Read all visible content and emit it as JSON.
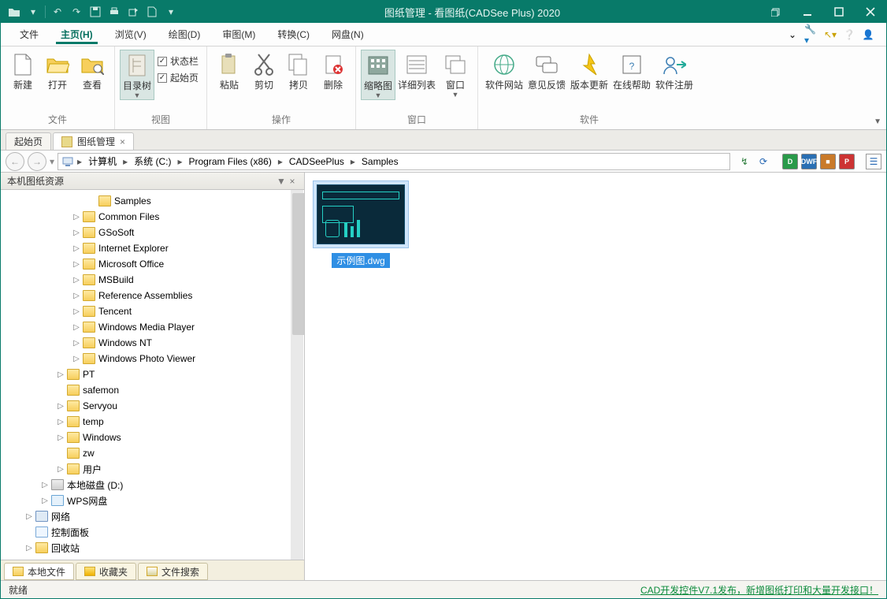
{
  "title": "图纸管理 - 看图纸(CADSee Plus) 2020",
  "menus": {
    "file": "文件",
    "home": "主页(H)",
    "browse": "浏览(V)",
    "draw": "绘图(D)",
    "review": "审图(M)",
    "convert": "转换(C)",
    "cloud": "网盘(N)"
  },
  "ribbon": {
    "file": {
      "label": "文件",
      "new": "新建",
      "open": "打开",
      "view": "查看"
    },
    "view": {
      "label": "视图",
      "tree": "目录树",
      "chk_status": "状态栏",
      "chk_start": "起始页"
    },
    "ops": {
      "label": "操作",
      "paste": "粘贴",
      "cut": "剪切",
      "copy": "拷贝",
      "del": "删除"
    },
    "win": {
      "label": "窗口",
      "thumb": "缩略图",
      "detail": "详细列表",
      "window": "窗口"
    },
    "soft": {
      "label": "软件",
      "site": "软件网站",
      "feedback": "意见反馈",
      "update": "版本更新",
      "help": "在线帮助",
      "reg": "软件注册"
    }
  },
  "tabs": {
    "start": "起始页",
    "mgr": "图纸管理"
  },
  "addr": {
    "segs": [
      "计算机",
      "系统 (C:)",
      "Program Files (x86)",
      "CADSeePlus",
      "Samples"
    ]
  },
  "sidebar": {
    "title": "本机图纸资源",
    "bottom_tabs": {
      "local": "本地文件",
      "fav": "收藏夹",
      "search": "文件搜索"
    },
    "nodes": [
      {
        "indent": 110,
        "tw": "",
        "icon": "folder",
        "label": "Samples",
        "sel": false
      },
      {
        "indent": 90,
        "tw": "▷",
        "icon": "folder",
        "label": "Common Files"
      },
      {
        "indent": 90,
        "tw": "▷",
        "icon": "folder",
        "label": "GSoSoft"
      },
      {
        "indent": 90,
        "tw": "▷",
        "icon": "folder",
        "label": "Internet Explorer"
      },
      {
        "indent": 90,
        "tw": "▷",
        "icon": "folder",
        "label": "Microsoft Office"
      },
      {
        "indent": 90,
        "tw": "▷",
        "icon": "folder",
        "label": "MSBuild"
      },
      {
        "indent": 90,
        "tw": "▷",
        "icon": "folder",
        "label": "Reference Assemblies"
      },
      {
        "indent": 90,
        "tw": "▷",
        "icon": "folder",
        "label": "Tencent"
      },
      {
        "indent": 90,
        "tw": "▷",
        "icon": "folder",
        "label": "Windows Media Player"
      },
      {
        "indent": 90,
        "tw": "▷",
        "icon": "folder",
        "label": "Windows NT"
      },
      {
        "indent": 90,
        "tw": "▷",
        "icon": "folder",
        "label": "Windows Photo Viewer"
      },
      {
        "indent": 70,
        "tw": "▷",
        "icon": "folder",
        "label": "PT"
      },
      {
        "indent": 70,
        "tw": "",
        "icon": "folder",
        "label": "safemon"
      },
      {
        "indent": 70,
        "tw": "▷",
        "icon": "folder",
        "label": "Servyou"
      },
      {
        "indent": 70,
        "tw": "▷",
        "icon": "folder",
        "label": "temp"
      },
      {
        "indent": 70,
        "tw": "▷",
        "icon": "folder",
        "label": "Windows"
      },
      {
        "indent": 70,
        "tw": "",
        "icon": "folder",
        "label": "zw"
      },
      {
        "indent": 70,
        "tw": "▷",
        "icon": "folder",
        "label": "用户"
      },
      {
        "indent": 50,
        "tw": "▷",
        "icon": "drive",
        "label": "本地磁盘 (D:)"
      },
      {
        "indent": 50,
        "tw": "▷",
        "icon": "cloud",
        "label": "WPS网盘"
      },
      {
        "indent": 30,
        "tw": "▷",
        "icon": "net",
        "label": "网络"
      },
      {
        "indent": 30,
        "tw": "",
        "icon": "cp",
        "label": "控制面板"
      },
      {
        "indent": 30,
        "tw": "▷",
        "icon": "folder",
        "label": "回收站"
      }
    ]
  },
  "file_item": {
    "name": "示例图.dwg"
  },
  "status": {
    "ready": "就绪",
    "link": "CAD开发控件V7.1发布，新增图纸打印和大量开发接口！"
  }
}
